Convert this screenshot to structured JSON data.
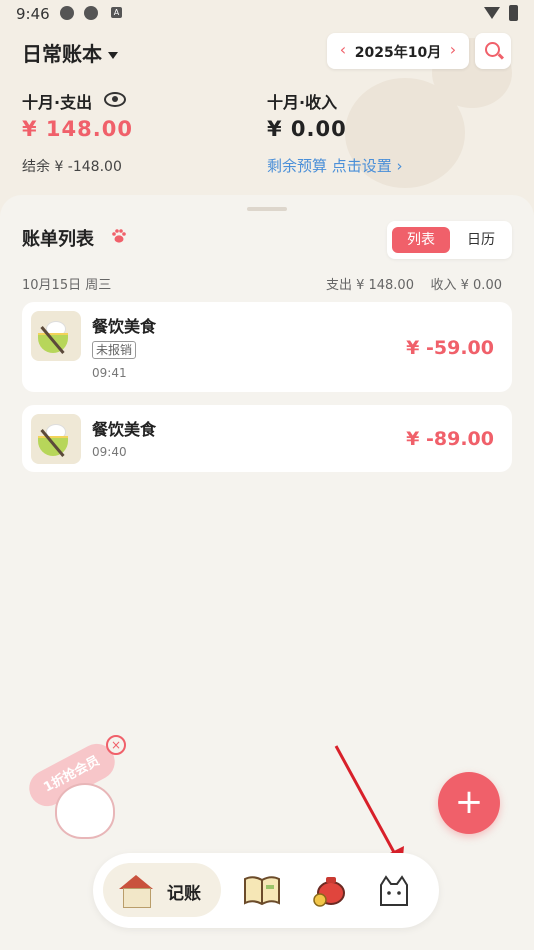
{
  "status": {
    "time": "9:46",
    "icon_a": "A"
  },
  "header": {
    "book_name": "日常账本",
    "month_label": "2025年10月",
    "prev_arrow": "‹",
    "next_arrow": "›"
  },
  "summary": {
    "expense_label": "十月·支出",
    "expense_value": "¥ 148.00",
    "income_label": "十月·收入",
    "income_value": "¥ 0.00",
    "balance_text": "结余  ¥ -148.00",
    "budget_text": "剩余预算  点击设置 ›"
  },
  "bills": {
    "title": "账单列表",
    "tabs": {
      "list": "列表",
      "calendar": "日历"
    },
    "day": {
      "date": "10月15日 周三",
      "totals": "支出 ¥ 148.00    收入 ¥ 0.00"
    },
    "items": [
      {
        "category": "餐饮美食",
        "tag": "未报销",
        "time": "09:41",
        "amount": "¥ -59.00"
      },
      {
        "category": "餐饮美食",
        "time": "09:40",
        "amount": "¥ -89.00"
      }
    ]
  },
  "promo": {
    "text": "1折抢会员",
    "close": "×"
  },
  "fab": {
    "label": "+"
  },
  "nav": {
    "active_label": "记账",
    "icons": [
      "house-cat-icon",
      "book-icon",
      "money-bag-icon",
      "cat-profile-icon"
    ]
  },
  "colors": {
    "accent": "#f0606a",
    "link": "#4a8fd8",
    "background": "#f4f1ea"
  }
}
